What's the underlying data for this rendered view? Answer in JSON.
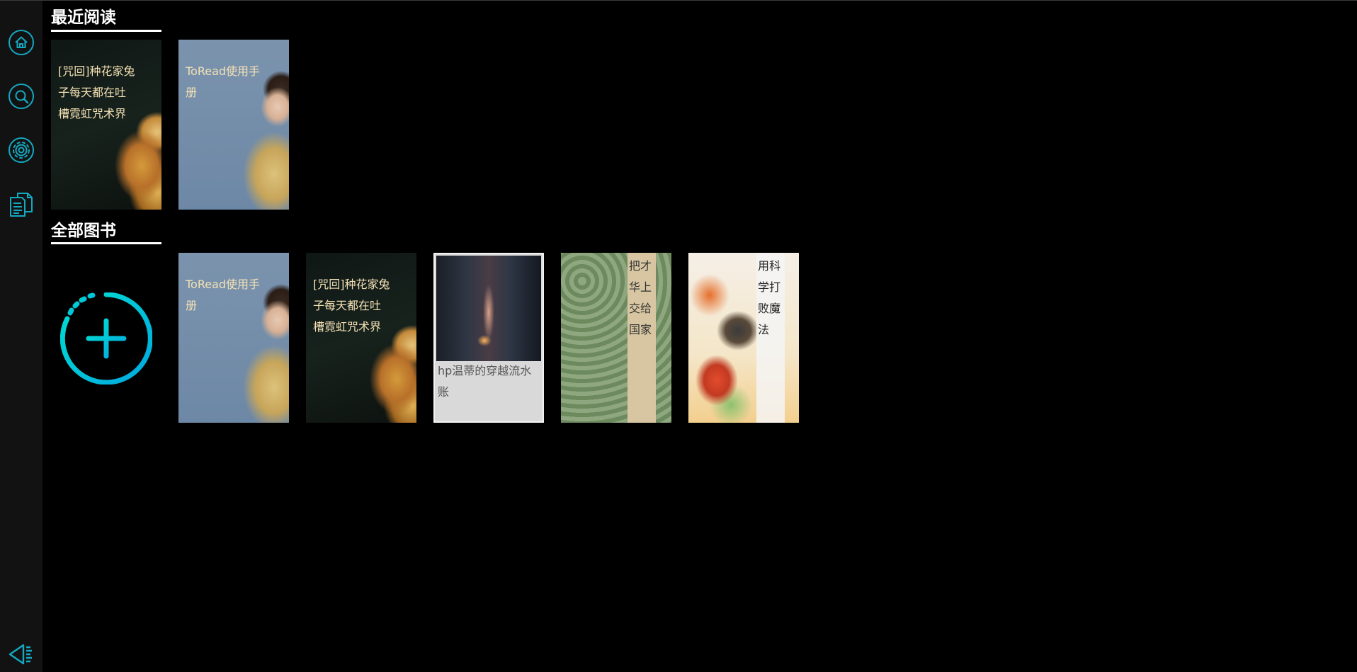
{
  "sidebar": {
    "items": [
      {
        "icon": "home-icon"
      },
      {
        "icon": "search-icon"
      },
      {
        "icon": "gear-icon"
      },
      {
        "icon": "document-icon"
      }
    ],
    "collapse_icon": "collapse-icon"
  },
  "sections": {
    "recent": {
      "title": "最近阅读",
      "books": [
        {
          "title": "[咒回]种花家兔子每天都在吐槽霓虹咒术界"
        },
        {
          "title": "ToRead使用手册"
        }
      ]
    },
    "all": {
      "title": "全部图书",
      "add_icon": "add-book-icon",
      "books": [
        {
          "title": "ToRead使用手册"
        },
        {
          "title": "[咒回]种花家兔子每天都在吐槽霓虹咒术界"
        },
        {
          "title": "hp温蒂的穿越流水账"
        },
        {
          "title": "把才华上交给国家"
        },
        {
          "title": "用科学打败魔法"
        }
      ]
    }
  },
  "colors": {
    "accent": "#14a9c2",
    "add_gradient_start": "#00d2d2",
    "add_gradient_end": "#00a8e0",
    "sidebar_bg": "#121212",
    "page_bg": "#000000"
  }
}
